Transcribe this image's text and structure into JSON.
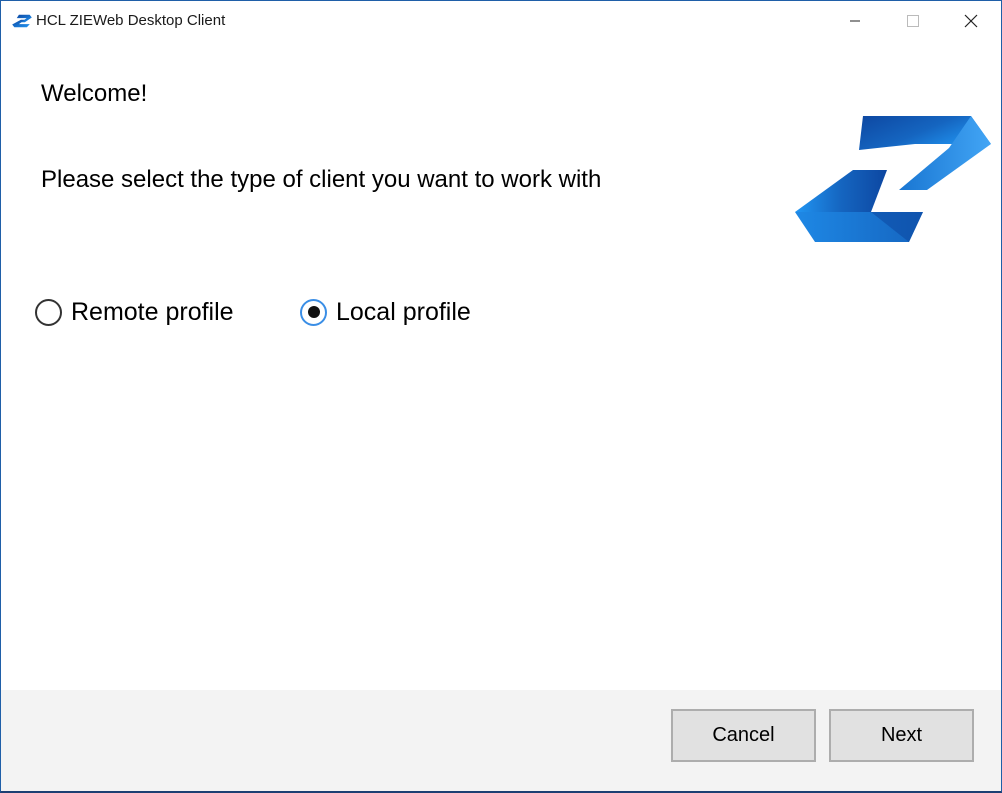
{
  "window": {
    "title": "HCL ZIEWeb Desktop Client",
    "controls": {
      "minimize_icon": "minimize-icon",
      "maximize_icon": "maximize-icon",
      "close_icon": "close-icon"
    }
  },
  "content": {
    "heading": "Welcome!",
    "instruction": "Please select the type of client you want to work with",
    "options": [
      {
        "label": "Remote profile",
        "selected": false
      },
      {
        "label": "Local profile",
        "selected": true
      }
    ]
  },
  "footer": {
    "cancel_label": "Cancel",
    "next_label": "Next"
  },
  "colors": {
    "brand_blue": "#1565c0",
    "brand_light_blue": "#2196f3",
    "radio_focus": "#3a8ee6",
    "footer_bg": "#f3f3f3",
    "button_bg": "#e1e1e1"
  }
}
